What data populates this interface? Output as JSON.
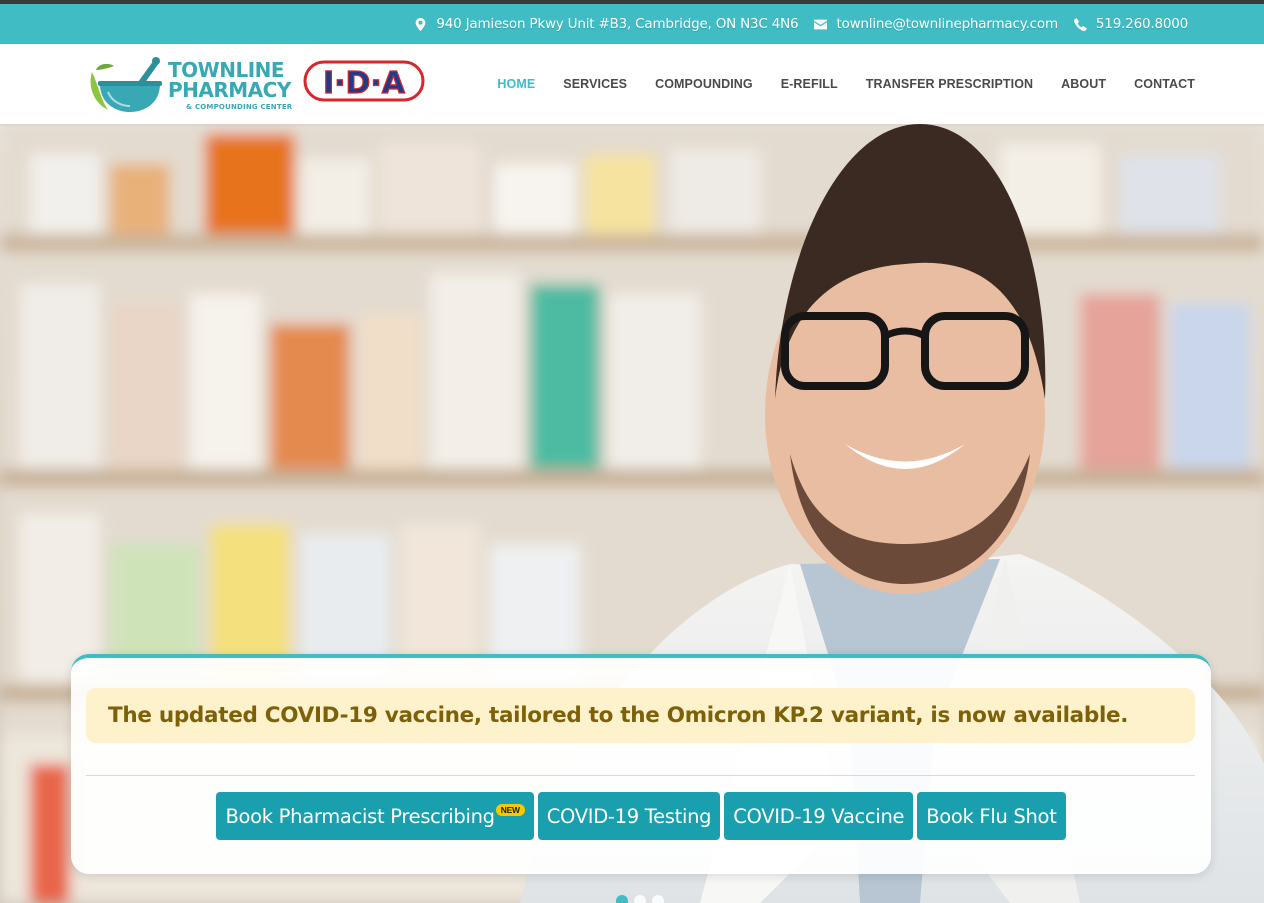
{
  "topbar": {
    "address": "940 Jamieson Pkwy Unit #B3, Cambridge, ON N3C 4N6",
    "email": "townline@townlinepharmacy.com",
    "phone": "519.260.8000"
  },
  "logo": {
    "line1": "TOWNLINE",
    "line2": "PHARMACY",
    "tagline": "& COMPOUNDING CENTER",
    "partner": "I·D·A"
  },
  "nav": {
    "items": [
      {
        "label": "HOME",
        "active": true
      },
      {
        "label": "SERVICES"
      },
      {
        "label": "COMPOUNDING"
      },
      {
        "label": "E-REFILL"
      },
      {
        "label": "TRANSFER PRESCRIPTION"
      },
      {
        "label": "ABOUT"
      },
      {
        "label": "CONTACT"
      }
    ]
  },
  "hero": {
    "notice": "The updated COVID-19 vaccine, tailored to the Omicron KP.2 variant, is now available.",
    "buttons": [
      {
        "label": "Book Pharmacist Prescribing",
        "badge": "NEW"
      },
      {
        "label": "COVID-19 Testing"
      },
      {
        "label": "COVID-19 Vaccine"
      },
      {
        "label": "Book Flu Shot"
      }
    ],
    "slide_active": 1,
    "slide_count": 3
  },
  "colors": {
    "brand_teal": "#3fbcc4",
    "button_teal": "#1a9fae",
    "notice_bg": "#fdf2cc",
    "notice_text": "#7d6008",
    "ida_red": "#d9252c",
    "ida_blue": "#1d3c8c",
    "badge_yellow": "#f7c800"
  }
}
